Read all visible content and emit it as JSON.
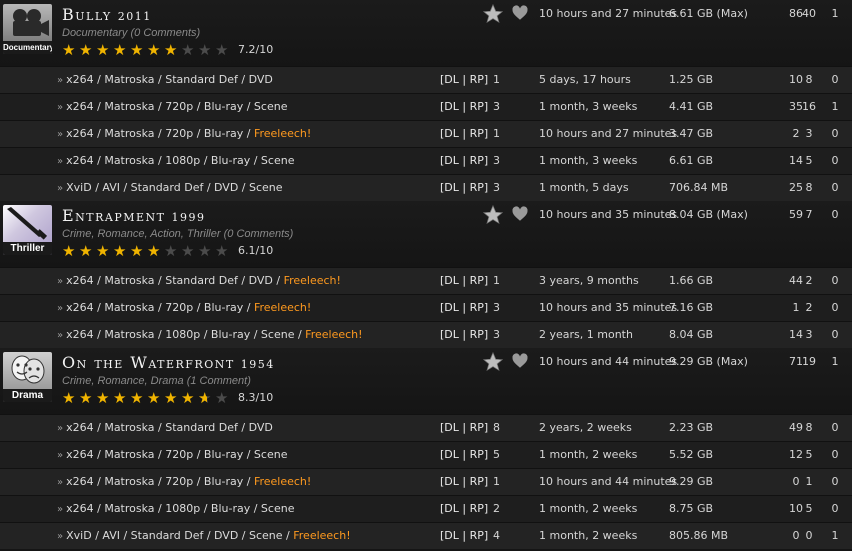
{
  "groups": [
    {
      "title": "Bully",
      "year": "2011",
      "genre_label": "Documentary",
      "tags": [],
      "tags_prefix": "Documentary",
      "comments_text": "0 Comments",
      "rating": 7.2,
      "rating_text": "7.2/10",
      "stats": {
        "age": "10 hours and 27 minutes",
        "size": "6.61 GB (Max)",
        "snatches": "86",
        "seeders": "40",
        "leechers": "1"
      },
      "torrents": [
        {
          "format": "x264 / Matroska / Standard Def / DVD",
          "freeleech": "",
          "files": "1",
          "age": "5 days, 17 hours",
          "size": "1.25 GB",
          "snatches": "10",
          "seeders": "8",
          "leechers": "0"
        },
        {
          "format": "x264 / Matroska / 720p / Blu-ray / Scene",
          "freeleech": "",
          "files": "3",
          "age": "1 month, 3 weeks",
          "size": "4.41 GB",
          "snatches": "35",
          "seeders": "16",
          "leechers": "1"
        },
        {
          "format": "x264 / Matroska / 720p / Blu-ray / ",
          "freeleech": "Freeleech!",
          "files": "1",
          "age": "10 hours and 27 minutes",
          "size": "3.47 GB",
          "snatches": "2",
          "seeders": "3",
          "leechers": "0"
        },
        {
          "format": "x264 / Matroska / 1080p / Blu-ray / Scene",
          "freeleech": "",
          "files": "3",
          "age": "1 month, 3 weeks",
          "size": "6.61 GB",
          "snatches": "14",
          "seeders": "5",
          "leechers": "0"
        },
        {
          "format": "XviD / AVI / Standard Def / DVD / Scene",
          "freeleech": "",
          "files": "3",
          "age": "1 month, 5 days",
          "size": "706.84 MB",
          "snatches": "25",
          "seeders": "8",
          "leechers": "0"
        }
      ]
    },
    {
      "title": "Entrapment",
      "year": "1999",
      "genre_label": "Thriller",
      "tags_prefix": "Crime, Romance, Action, Thriller",
      "comments_text": "0 Comments",
      "rating": 6.1,
      "rating_text": "6.1/10",
      "stats": {
        "age": "10 hours and 35 minutes",
        "size": "8.04 GB (Max)",
        "snatches": "59",
        "seeders": "7",
        "leechers": "0"
      },
      "torrents": [
        {
          "format": "x264 / Matroska / Standard Def / DVD / ",
          "freeleech": "Freeleech!",
          "files": "1",
          "age": "3 years, 9 months",
          "size": "1.66 GB",
          "snatches": "44",
          "seeders": "2",
          "leechers": "0"
        },
        {
          "format": "x264 / Matroska / 720p / Blu-ray / ",
          "freeleech": "Freeleech!",
          "files": "3",
          "age": "10 hours and 35 minutes",
          "size": "7.16 GB",
          "snatches": "1",
          "seeders": "2",
          "leechers": "0"
        },
        {
          "format": "x264 / Matroska / 1080p / Blu-ray / Scene / ",
          "freeleech": "Freeleech!",
          "files": "3",
          "age": "2 years, 1 month",
          "size": "8.04 GB",
          "snatches": "14",
          "seeders": "3",
          "leechers": "0"
        }
      ]
    },
    {
      "title": "On the Waterfront",
      "year": "1954",
      "genre_label": "Drama",
      "tags_prefix": "Crime, Romance, Drama",
      "comments_text": "1 Comment",
      "rating": 8.3,
      "rating_text": "8.3/10",
      "stats": {
        "age": "10 hours and 44 minutes",
        "size": "9.29 GB (Max)",
        "snatches": "71",
        "seeders": "19",
        "leechers": "1"
      },
      "torrents": [
        {
          "format": "x264 / Matroska / Standard Def / DVD",
          "freeleech": "",
          "files": "8",
          "age": "2 years, 2 weeks",
          "size": "2.23 GB",
          "snatches": "49",
          "seeders": "8",
          "leechers": "0"
        },
        {
          "format": "x264 / Matroska / 720p / Blu-ray / Scene",
          "freeleech": "",
          "files": "5",
          "age": "1 month, 2 weeks",
          "size": "5.52 GB",
          "snatches": "12",
          "seeders": "5",
          "leechers": "0"
        },
        {
          "format": "x264 / Matroska / 720p / Blu-ray / ",
          "freeleech": "Freeleech!",
          "files": "1",
          "age": "10 hours and 44 minutes",
          "size": "9.29 GB",
          "snatches": "0",
          "seeders": "1",
          "leechers": "0"
        },
        {
          "format": "x264 / Matroska / 1080p / Blu-ray / Scene",
          "freeleech": "",
          "files": "2",
          "age": "1 month, 2 weeks",
          "size": "8.75 GB",
          "snatches": "10",
          "seeders": "5",
          "leechers": "0"
        },
        {
          "format": "XviD / AVI / Standard Def / DVD / Scene / ",
          "freeleech": "Freeleech!",
          "files": "4",
          "age": "1 month, 2 weeks",
          "size": "805.86 MB",
          "snatches": "0",
          "seeders": "0",
          "leechers": "1"
        }
      ]
    }
  ],
  "labels": {
    "dl": "DL",
    "rp": "RP"
  },
  "icons": {
    "bullet": "»",
    "fav": "star-bookmark-icon",
    "heart": "heart-icon"
  },
  "colors": {
    "freeleech": "#ff9a1f",
    "star_on": "#f0b400",
    "star_off": "#4b4b4b"
  }
}
